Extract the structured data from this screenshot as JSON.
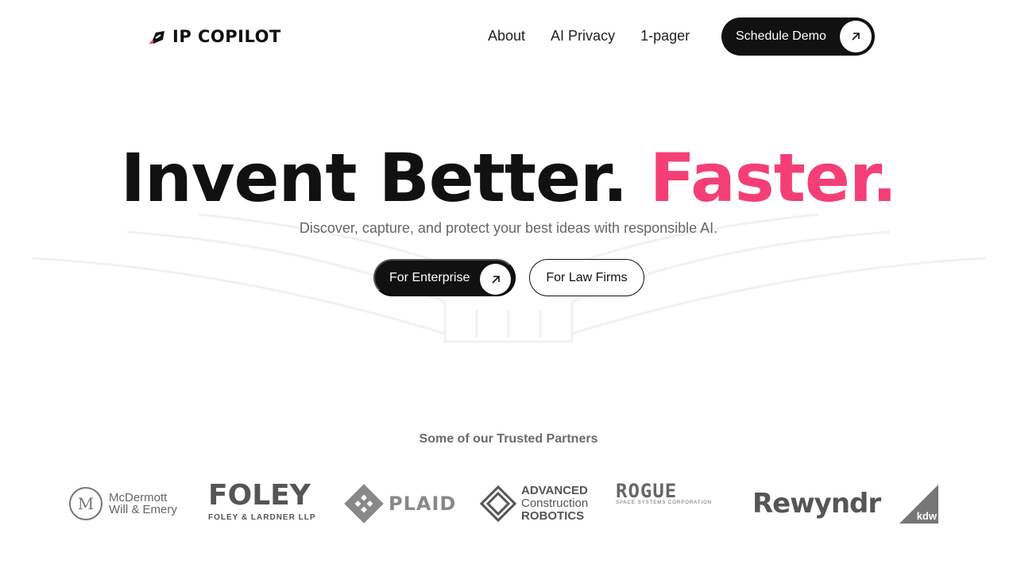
{
  "nav": {
    "logo_text": "IP COPILOT",
    "links": [
      {
        "label": "About"
      },
      {
        "label": "AI Privacy"
      },
      {
        "label": "1-pager"
      }
    ],
    "demo_label": "Schedule Demo"
  },
  "hero": {
    "title_main": "Invent Better.",
    "title_accent": "Faster.",
    "subtitle": "Discover, capture, and protect your best ideas with responsible AI.",
    "cta_primary": "For Enterprise",
    "cta_secondary": "For Law Firms"
  },
  "partners": {
    "title": "Some of our Trusted Partners",
    "mcdermott_mark": "M",
    "mcdermott_line1": "McDermott",
    "mcdermott_line2": "Will & Emery",
    "foley_big": "FOLEY",
    "foley_small": "FOLEY & LARDNER LLP",
    "plaid": "PLAID",
    "acr_line1": "ADVANCED",
    "acr_line2": "Construction",
    "acr_line3": "ROBOTICS",
    "rogue": "ROGUE",
    "rogue_small": "SPACE SYSTEMS CORPORATION",
    "rewyndr": "Rewyndr",
    "kdw": "kdw"
  },
  "colors": {
    "accent": "#f43f76",
    "dark": "#111111",
    "muted": "#6b6b6b"
  },
  "icons": [
    "arrow-up-right-icon",
    "logo-mark-icon"
  ]
}
